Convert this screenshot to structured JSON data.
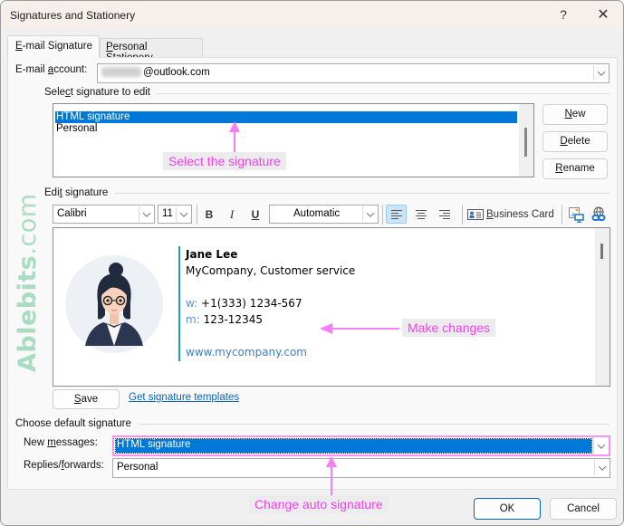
{
  "window": {
    "title": "Signatures and Stationery",
    "help_label": "?",
    "close_label": "✕"
  },
  "tabs": [
    {
      "label_first": "E",
      "label_rest": "-mail Signature",
      "active": true
    },
    {
      "label_first": "P",
      "label_rest": "ersonal Stationery",
      "active": false
    }
  ],
  "email_account": {
    "label_pre": "E-mail ",
    "label_u": "a",
    "label_post": "ccount:",
    "value_suffix": "@outlook.com"
  },
  "select_signature": {
    "group_label_pre": "Sele",
    "group_label_u": "c",
    "group_label_post": "t signature to edit",
    "items": [
      {
        "label": "HTML signature",
        "selected": true
      },
      {
        "label": "Personal",
        "selected": false
      }
    ],
    "buttons": {
      "new": {
        "u": "N",
        "rest": "ew"
      },
      "delete": {
        "u": "D",
        "rest": "elete"
      },
      "rename": {
        "u": "R",
        "rest": "ename"
      }
    }
  },
  "edit_signature": {
    "group_label_pre": "Edi",
    "group_label_u": "t",
    "group_label_post": " signature",
    "toolbar": {
      "font": "Calibri",
      "size": "11",
      "bold": "B",
      "italic": "I",
      "underline": "U",
      "color": "Automatic",
      "business_card_u": "B",
      "business_card_rest": "usiness Card",
      "alignment": "left"
    },
    "signature": {
      "name": "Jane Lee",
      "company": "MyCompany, Customer service",
      "work_prefix": "w:",
      "work_phone": "+1(333) 1234-567",
      "mobile_prefix": "m:",
      "mobile_phone": "123-12345",
      "website": "www.mycompany.com"
    },
    "save": {
      "u": "S",
      "rest": "ave"
    },
    "templates_link": "Get signature templates"
  },
  "default_signature": {
    "group_label": "Choose default signature",
    "new_messages": {
      "label_pre": "New ",
      "label_u": "m",
      "label_post": "essages:",
      "value": "HTML signature"
    },
    "replies": {
      "label_pre": "Replies/",
      "label_u": "f",
      "label_post": "orwards:",
      "value": "Personal"
    }
  },
  "footer": {
    "ok": "OK",
    "cancel": "Cancel"
  },
  "annotations": {
    "select": "Select the signature",
    "changes": "Make changes",
    "auto": "Change auto signature"
  },
  "watermark": {
    "bold": "Ablebits",
    "light": ".com"
  },
  "colors": {
    "selection": "#0078d7",
    "annotation": "#f53ef0",
    "signature_bar": "#1a9ed8",
    "link": "#0563c1"
  }
}
